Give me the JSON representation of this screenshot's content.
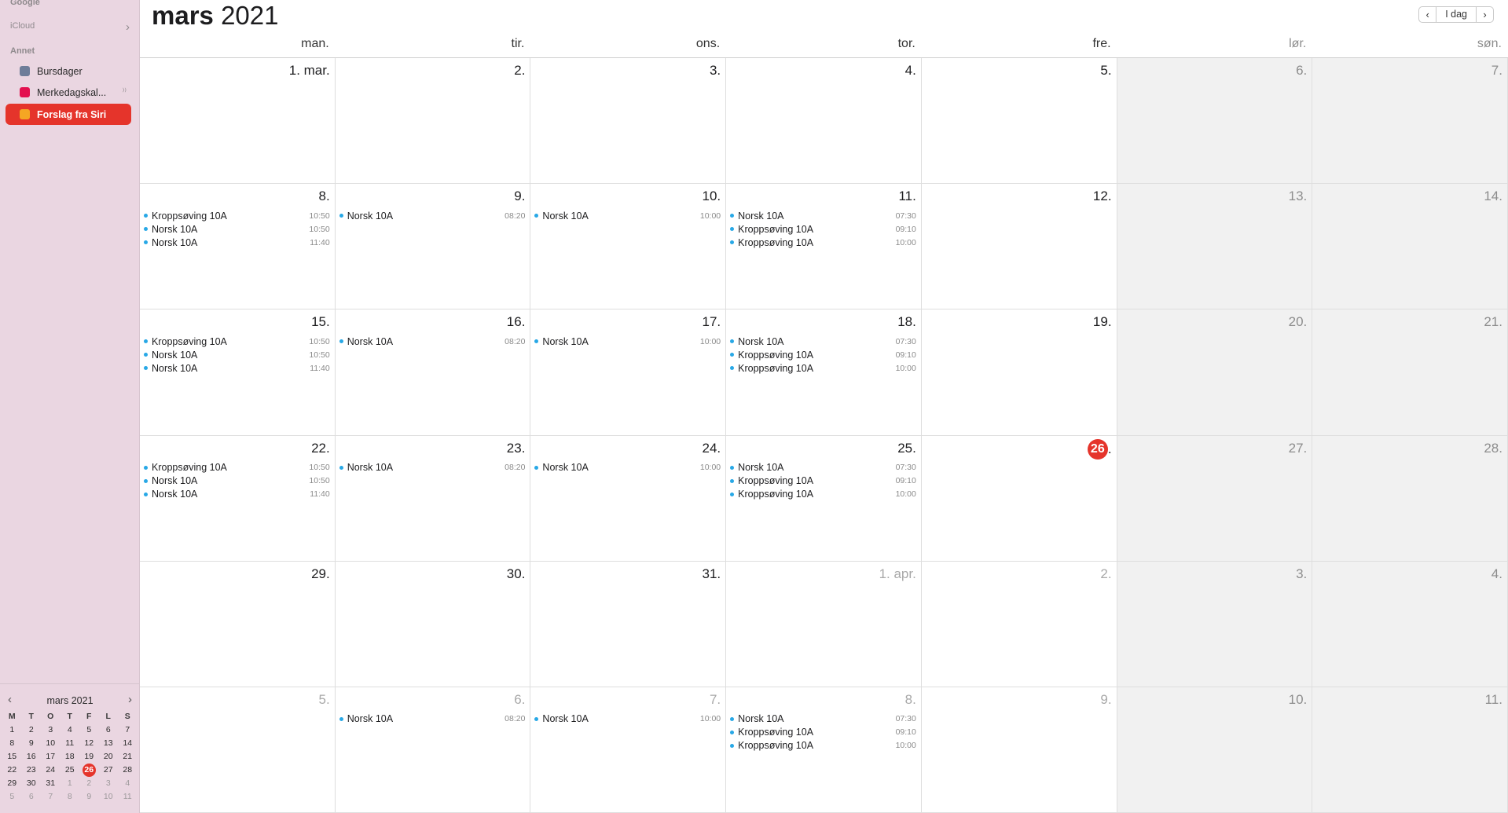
{
  "sidebar": {
    "section_top": "Google",
    "icloud": "iCloud",
    "other": "Annet",
    "calendars": [
      {
        "label": "Bursdager",
        "color": "#6e7d99",
        "selected": false
      },
      {
        "label": "Merkedagskal...",
        "color": "#e3104f",
        "selected": false
      },
      {
        "label": "Forslag fra Siri",
        "color": "#f5a623",
        "selected": true
      }
    ]
  },
  "mini_calendar": {
    "title": "mars 2021",
    "prev_icon": "chevron-left-icon",
    "next_icon": "chevron-right-icon",
    "weekday_headers": [
      "M",
      "T",
      "O",
      "T",
      "F",
      "L",
      "S"
    ],
    "weeks": [
      [
        "1",
        "2",
        "3",
        "4",
        "5",
        "6",
        "7"
      ],
      [
        "8",
        "9",
        "10",
        "11",
        "12",
        "13",
        "14"
      ],
      [
        "15",
        "16",
        "17",
        "18",
        "19",
        "20",
        "21"
      ],
      [
        "22",
        "23",
        "24",
        "25",
        "26",
        "27",
        "28"
      ],
      [
        "29",
        "30",
        "31",
        "1",
        "2",
        "3",
        "4"
      ],
      [
        "5",
        "6",
        "7",
        "8",
        "9",
        "10",
        "11"
      ]
    ],
    "today": "26"
  },
  "header": {
    "month": "mars",
    "year": "2021",
    "today_button": "I dag"
  },
  "weekdays": [
    "man.",
    "tir.",
    "ons.",
    "tor.",
    "fre.",
    "lør.",
    "søn."
  ],
  "weeks": [
    [
      {
        "label": "1. mar.",
        "events": []
      },
      {
        "label": "2.",
        "events": []
      },
      {
        "label": "3.",
        "events": []
      },
      {
        "label": "4.",
        "events": []
      },
      {
        "label": "5.",
        "events": []
      },
      {
        "label": "6.",
        "events": []
      },
      {
        "label": "7.",
        "events": []
      }
    ],
    [
      {
        "label": "8.",
        "events": [
          {
            "title": "Kroppsøving 10A",
            "time": "10:50"
          },
          {
            "title": "Norsk 10A",
            "time": "10:50"
          },
          {
            "title": "Norsk 10A",
            "time": "11:40"
          }
        ]
      },
      {
        "label": "9.",
        "events": [
          {
            "title": "Norsk 10A",
            "time": "08:20"
          }
        ]
      },
      {
        "label": "10.",
        "events": [
          {
            "title": "Norsk 10A",
            "time": "10:00"
          }
        ]
      },
      {
        "label": "11.",
        "events": [
          {
            "title": "Norsk 10A",
            "time": "07:30"
          },
          {
            "title": "Kroppsøving 10A",
            "time": "09:10"
          },
          {
            "title": "Kroppsøving 10A",
            "time": "10:00"
          }
        ]
      },
      {
        "label": "12.",
        "events": []
      },
      {
        "label": "13.",
        "events": []
      },
      {
        "label": "14.",
        "events": []
      }
    ],
    [
      {
        "label": "15.",
        "events": [
          {
            "title": "Kroppsøving 10A",
            "time": "10:50"
          },
          {
            "title": "Norsk 10A",
            "time": "10:50"
          },
          {
            "title": "Norsk 10A",
            "time": "11:40"
          }
        ]
      },
      {
        "label": "16.",
        "events": [
          {
            "title": "Norsk 10A",
            "time": "08:20"
          }
        ]
      },
      {
        "label": "17.",
        "events": [
          {
            "title": "Norsk 10A",
            "time": "10:00"
          }
        ]
      },
      {
        "label": "18.",
        "events": [
          {
            "title": "Norsk 10A",
            "time": "07:30"
          },
          {
            "title": "Kroppsøving 10A",
            "time": "09:10"
          },
          {
            "title": "Kroppsøving 10A",
            "time": "10:00"
          }
        ]
      },
      {
        "label": "19.",
        "events": []
      },
      {
        "label": "20.",
        "events": []
      },
      {
        "label": "21.",
        "events": []
      }
    ],
    [
      {
        "label": "22.",
        "events": [
          {
            "title": "Kroppsøving 10A",
            "time": "10:50"
          },
          {
            "title": "Norsk 10A",
            "time": "10:50"
          },
          {
            "title": "Norsk 10A",
            "time": "11:40"
          }
        ]
      },
      {
        "label": "23.",
        "events": [
          {
            "title": "Norsk 10A",
            "time": "08:20"
          }
        ]
      },
      {
        "label": "24.",
        "events": [
          {
            "title": "Norsk 10A",
            "time": "10:00"
          }
        ]
      },
      {
        "label": "25.",
        "events": [
          {
            "title": "Norsk 10A",
            "time": "07:30"
          },
          {
            "title": "Kroppsøving 10A",
            "time": "09:10"
          },
          {
            "title": "Kroppsøving 10A",
            "time": "10:00"
          }
        ]
      },
      {
        "label": "26",
        "today": true,
        "events": []
      },
      {
        "label": "27.",
        "events": []
      },
      {
        "label": "28.",
        "events": []
      }
    ],
    [
      {
        "label": "29.",
        "events": []
      },
      {
        "label": "30.",
        "events": []
      },
      {
        "label": "31.",
        "events": []
      },
      {
        "label": "1. apr.",
        "other_month": true,
        "events": []
      },
      {
        "label": "2.",
        "other_month": true,
        "events": []
      },
      {
        "label": "3.",
        "other_month": true,
        "events": []
      },
      {
        "label": "4.",
        "other_month": true,
        "events": []
      }
    ],
    [
      {
        "label": "5.",
        "other_month": true,
        "events": []
      },
      {
        "label": "6.",
        "other_month": true,
        "events": [
          {
            "title": "Norsk 10A",
            "time": "08:20"
          }
        ]
      },
      {
        "label": "7.",
        "other_month": true,
        "events": [
          {
            "title": "Norsk 10A",
            "time": "10:00"
          }
        ]
      },
      {
        "label": "8.",
        "other_month": true,
        "events": [
          {
            "title": "Norsk 10A",
            "time": "07:30"
          },
          {
            "title": "Kroppsøving 10A",
            "time": "09:10"
          },
          {
            "title": "Kroppsøving 10A",
            "time": "10:00"
          }
        ]
      },
      {
        "label": "9.",
        "other_month": true,
        "events": []
      },
      {
        "label": "10.",
        "other_month": true,
        "events": []
      },
      {
        "label": "11.",
        "other_month": true,
        "events": []
      }
    ]
  ],
  "colors": {
    "accent": "#e5342b",
    "event_dot": "#28a8e6",
    "sidebar_bg": "#ead6e1"
  }
}
